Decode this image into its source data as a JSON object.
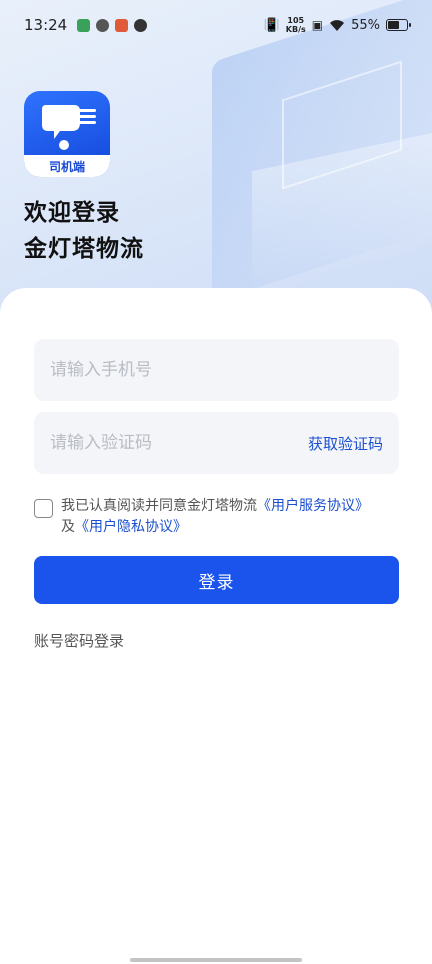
{
  "status_bar": {
    "time": "13:24",
    "net_speed_value": "105",
    "net_speed_unit": "KB/s",
    "battery": "55%",
    "battery_level": 0.55
  },
  "app": {
    "logo_label": "司机端",
    "welcome_line1": "欢迎登录",
    "welcome_line2": "金灯塔物流"
  },
  "form": {
    "phone_placeholder": "请输入手机号",
    "code_placeholder": "请输入验证码",
    "get_code_label": "获取验证码",
    "agreement_prefix": "我已认真阅读并同意金灯塔物流",
    "user_service_agreement": "《用户服务协议》",
    "agreement_join": "及",
    "privacy_agreement": "《用户隐私协议》",
    "login_label": "登录",
    "password_login_label": "账号密码登录"
  },
  "colors": {
    "accent": "#1a54ec",
    "link": "#1b4fd0"
  }
}
